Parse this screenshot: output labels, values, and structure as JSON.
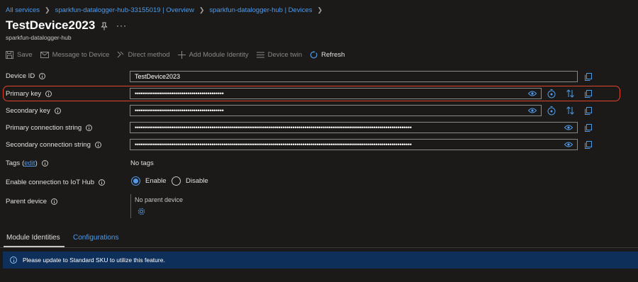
{
  "breadcrumb": [
    {
      "label": "All services"
    },
    {
      "label": "sparkfun-datalogger-hub-33155019 | Overview"
    },
    {
      "label": "sparkfun-datalogger-hub | Devices"
    }
  ],
  "page": {
    "title": "TestDevice2023",
    "subtitle": "sparkfun-datalogger-hub",
    "more": "···"
  },
  "toolbar": {
    "save": "Save",
    "message_to_device": "Message to Device",
    "direct_method": "Direct method",
    "add_module_identity": "Add Module Identity",
    "device_twin": "Device twin",
    "refresh": "Refresh"
  },
  "fields": {
    "device_id": {
      "label": "Device ID",
      "value": "TestDevice2023"
    },
    "primary_key": {
      "label": "Primary key",
      "value": "••••••••••••••••••••••••••••••••••••••••••••"
    },
    "secondary_key": {
      "label": "Secondary key",
      "value": "••••••••••••••••••••••••••••••••••••••••••••"
    },
    "primary_conn": {
      "label": "Primary connection string",
      "value": "•••••••••••••••••••••••••••••••••••••••••••••••••••••••••••••••••••••••••••••••••••••••••••••••••••••••••••••••••••••••••••••••••••••••••"
    },
    "secondary_conn": {
      "label": "Secondary connection string",
      "value": "•••••••••••••••••••••••••••••••••••••••••••••••••••••••••••••••••••••••••••••••••••••••••••••••••••••••••••••••••••••••••••••••••••••••••"
    }
  },
  "tags": {
    "label": "Tags",
    "edit": "edit",
    "open": "(",
    "close": ")",
    "value": "No tags"
  },
  "connection": {
    "label": "Enable connection to IoT Hub",
    "enable": "Enable",
    "disable": "Disable",
    "selected": "Enable"
  },
  "parent": {
    "label": "Parent device",
    "value": "No parent device"
  },
  "tabs": [
    {
      "label": "Module Identities",
      "active": true
    },
    {
      "label": "Configurations",
      "active": false
    }
  ],
  "banner": {
    "text": "Please update to Standard SKU to utilize this feature."
  },
  "colors": {
    "accent": "#4f9bea",
    "highlight": "#e0442b",
    "banner": "#0e2f5a"
  }
}
